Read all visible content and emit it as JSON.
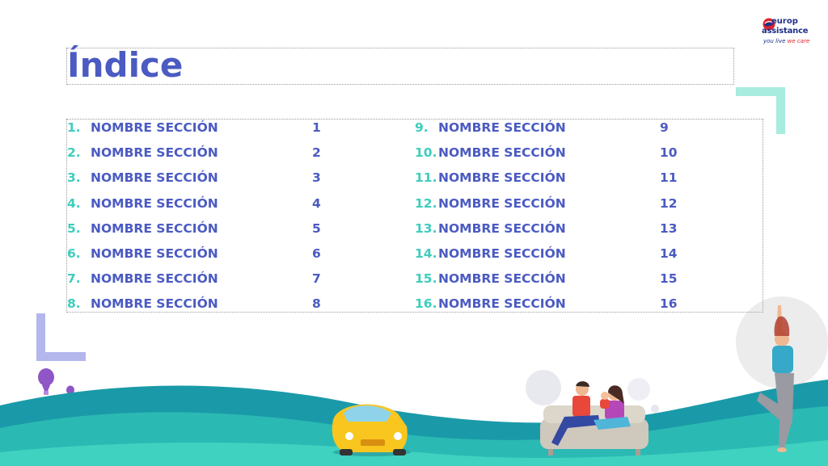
{
  "title": "Índice",
  "toc": [
    {
      "num": "1.",
      "label": "NOMBRE SECCIÓN",
      "page": "1"
    },
    {
      "num": "2.",
      "label": "NOMBRE SECCIÓN",
      "page": "2"
    },
    {
      "num": "3.",
      "label": "NOMBRE SECCIÓN",
      "page": "3"
    },
    {
      "num": "4.",
      "label": "NOMBRE SECCIÓN",
      "page": "4"
    },
    {
      "num": "5.",
      "label": "NOMBRE SECCIÓN",
      "page": "5"
    },
    {
      "num": "6.",
      "label": "NOMBRE SECCIÓN",
      "page": "6"
    },
    {
      "num": "7.",
      "label": "NOMBRE SECCIÓN",
      "page": "7"
    },
    {
      "num": "8.",
      "label": "NOMBRE SECCIÓN",
      "page": "8"
    },
    {
      "num": "9.",
      "label": "NOMBRE SECCIÓN",
      "page": "9"
    },
    {
      "num": "10.",
      "label": "NOMBRE SECCIÓN",
      "page": "10"
    },
    {
      "num": "11.",
      "label": "NOMBRE SECCIÓN",
      "page": "11"
    },
    {
      "num": "12.",
      "label": "NOMBRE SECCIÓN",
      "page": "12"
    },
    {
      "num": "13.",
      "label": "NOMBRE SECCIÓN",
      "page": "13"
    },
    {
      "num": "14.",
      "label": "NOMBRE SECCIÓN",
      "page": "14"
    },
    {
      "num": "15.",
      "label": "NOMBRE SECCIÓN",
      "page": "15"
    },
    {
      "num": "16.",
      "label": "NOMBRE SECCIÓN",
      "page": "16"
    }
  ],
  "logo": {
    "line1": "europ",
    "line2": "assistance",
    "tagline_a": "you live",
    "tagline_b": "we care"
  },
  "colors": {
    "title": "#4b5bc2",
    "number": "#3fcdbd",
    "text": "#4b5bc2",
    "wave_dark": "#1a9aa8",
    "wave_light": "#40d2c0",
    "accent_lavender": "#a9aee6",
    "accent_mint": "#a7ecdf",
    "brand_navy": "#1f2f88",
    "brand_red": "#e2252b"
  }
}
